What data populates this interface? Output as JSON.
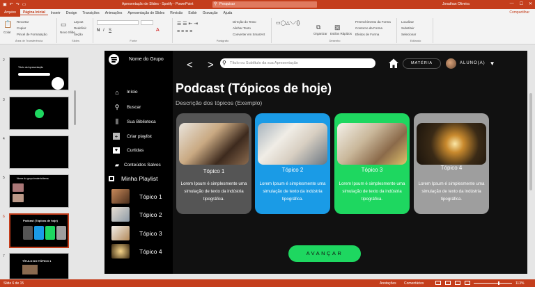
{
  "app": {
    "title": "Apresentação de Slides - Spotify - PowerPoint",
    "search_placeholder": "Pesquisar",
    "user": "Jonathan Oliveira",
    "share": "Compartilhar"
  },
  "menu": [
    "Arquivo",
    "Página Inicial",
    "Inserir",
    "Design",
    "Transições",
    "Animações",
    "Apresentação de Slides",
    "Revisão",
    "Exibir",
    "Gravação",
    "Ajuda"
  ],
  "ribbon": {
    "colar": "Colar",
    "recortar": "Recortar",
    "copiar": "Copiar",
    "pincel": "Pincel de Formatação",
    "area": "Área de Transferência",
    "novo_slide": "Novo Slide",
    "layout": "Layout",
    "redefinir": "Redefinir",
    "secao": "Seção",
    "slides": "Slides",
    "fonte": "Fonte",
    "paragrafo": "Parágrafo",
    "direcao": "Direção do Texto",
    "alinhar": "Alinhar Texto",
    "smartart": "Converter em SmartArt",
    "organizar": "Organizar",
    "estilos_rapidos": "Estilos Rápidos",
    "preench": "Preenchimento da Forma",
    "contorno": "Contorno da Forma",
    "efeitos": "Efeitos de Forma",
    "desenho": "Desenho",
    "localizar": "Localizar",
    "substituir": "Substituir",
    "selecionar": "Selecionar",
    "editando": "Editando"
  },
  "slides_panel": [
    "2",
    "3",
    "4",
    "5",
    "6",
    "7"
  ],
  "thumb_texts": {
    "t2": "Título da Apresentação",
    "t5": "Nome do grupo/materia/tema",
    "t6": "Podcast (Tópicos de hoje)",
    "t7": "TÍTULO DO TÓPICO 1"
  },
  "slide": {
    "group_name": "Nome do Grupo",
    "nav": [
      "Início",
      "Buscar",
      "Sua Biblioteca",
      "Criar playlist",
      "Curtidas",
      "Conteúdos Salvos"
    ],
    "playlist_title": "Minha Playlist",
    "playlist_items": [
      "Tópico 1",
      "Tópico 2",
      "Tópico 3",
      "Tópico 4"
    ],
    "search_placeholder": "Título ou Subtítulo da sua Apresentação",
    "materia": "MATÉRIA",
    "aluno": "ALUNO(A)",
    "title": "Podcast (Tópicos de hoje)",
    "description": "Descrição dos tópicos (Exemplo)",
    "cards": [
      {
        "title": "Tópico 1",
        "text": "Lorem Ipsum é simplesmente uma simulação de texto da indústria tipográfica.",
        "color": "#555555"
      },
      {
        "title": "Tópico 2",
        "text": "Lorem Ipsum é simplesmente uma simulação de texto da indústria tipográfica.",
        "color": "#1a9be6"
      },
      {
        "title": "Tópico 3",
        "text": "Lorem Ipsum é simplesmente uma simulação de texto da indústria tipográfica.",
        "color": "#1ed760"
      },
      {
        "title": "Tópico 4",
        "text": "Lorem Ipsum é simplesmente uma simulação de texto da indústria tipográfica.",
        "color": "#9e9e9e"
      }
    ],
    "button": "AVANÇAR"
  },
  "status": {
    "slide": "Slide 6 de 15",
    "anotacoes": "Anotações",
    "comentarios": "Comentários",
    "zoom": "113%"
  }
}
